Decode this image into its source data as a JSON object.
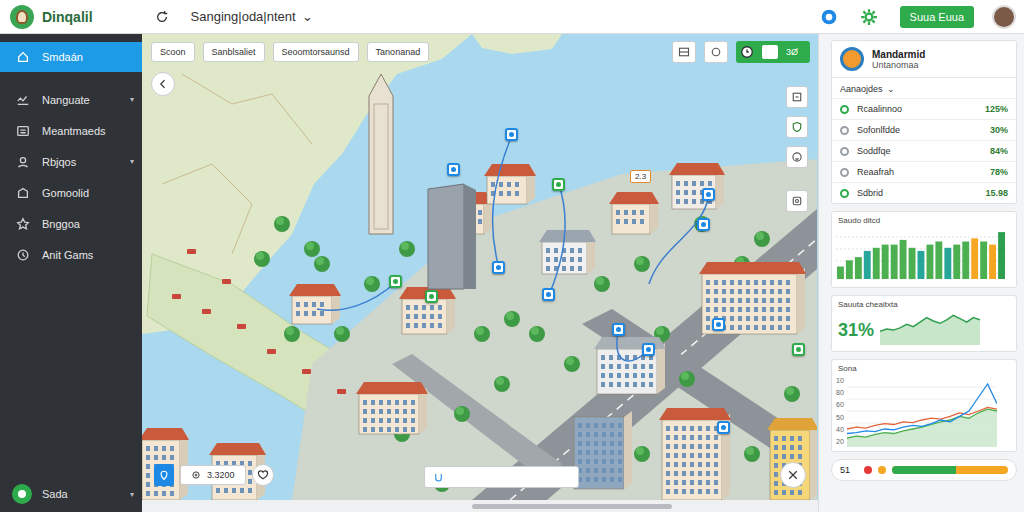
{
  "app": {
    "name": "Dinqalil",
    "project": "Sanging|oda|ntent",
    "project_caret": "⌄"
  },
  "header": {
    "button": "Suua Euua"
  },
  "sidebar": {
    "items": [
      {
        "label": "Smdaán",
        "selected": true,
        "expandable": false
      },
      {
        "label": "Nanguate",
        "selected": false,
        "expandable": true
      },
      {
        "label": "Meantmaeds",
        "selected": false,
        "expandable": false
      },
      {
        "label": "Rbjqos",
        "selected": false,
        "expandable": true
      },
      {
        "label": "Gomoolid",
        "selected": false,
        "expandable": false
      },
      {
        "label": "Bnggoa",
        "selected": false,
        "expandable": false
      },
      {
        "label": "Anit Gams",
        "selected": false,
        "expandable": false
      }
    ],
    "caret": "▾",
    "footer": {
      "label": "Sada",
      "caret": "▾"
    }
  },
  "map": {
    "filters": [
      "Scoon",
      "Sanblsaliet",
      "Seoomtorsaunsd",
      "Tanonanad"
    ],
    "action": "3Ø",
    "badge": "2.3",
    "scale": "3.3200",
    "pins": [
      {
        "color": "#1e88e5"
      },
      {
        "color": "#1e88e5"
      },
      {
        "color": "#2eab4a"
      },
      {
        "color": "#1e88e5"
      },
      {
        "color": "#1e88e5"
      },
      {
        "color": "#1e88e5"
      },
      {
        "color": "#1e88e5"
      },
      {
        "color": "#1e88e5"
      },
      {
        "color": "#1e88e5"
      },
      {
        "color": "#1e88e5"
      },
      {
        "color": "#2eab4a"
      },
      {
        "color": "#1e88e5"
      },
      {
        "color": "#2eab4a"
      },
      {
        "color": "#2eab4a"
      }
    ]
  },
  "panel": {
    "title": "Mandarmid",
    "subtitle": "Untanomaa",
    "list_title": "Aanaojdes",
    "list_caret": "⌄",
    "rows": [
      {
        "label": "Rcaalinnoo",
        "value": "125%",
        "color": "#2eab4a"
      },
      {
        "label": "Sofonlfdde",
        "value": "30%",
        "color": "#9aa0a6"
      },
      {
        "label": "Soddfqe",
        "value": "84%",
        "color": "#9aa0a6"
      },
      {
        "label": "Reaafrah",
        "value": "78%",
        "color": "#9aa0a6"
      },
      {
        "label": "Sdbrid",
        "value": "15.98",
        "color": "#2eab4a"
      }
    ],
    "bar_chart": {
      "title": "Saudo ditcd",
      "bars": [
        {
          "value": 8,
          "color": "#4caf50"
        },
        {
          "value": 12,
          "color": "#4caf50"
        },
        {
          "value": 14,
          "color": "#4caf50"
        },
        {
          "value": 18,
          "color": "#26a69a"
        },
        {
          "value": 20,
          "color": "#4caf50"
        },
        {
          "value": 22,
          "color": "#4caf50"
        },
        {
          "value": 22,
          "color": "#4caf50"
        },
        {
          "value": 25,
          "color": "#4caf50"
        },
        {
          "value": 20,
          "color": "#4caf50"
        },
        {
          "value": 18,
          "color": "#26a69a"
        },
        {
          "value": 22,
          "color": "#4caf50"
        },
        {
          "value": 24,
          "color": "#4caf50"
        },
        {
          "value": 20,
          "color": "#26a69a"
        },
        {
          "value": 22,
          "color": "#4caf50"
        },
        {
          "value": 24,
          "color": "#4caf50"
        },
        {
          "value": 26,
          "color": "#f5a623"
        },
        {
          "value": 24,
          "color": "#4caf50"
        },
        {
          "value": 22,
          "color": "#f5a623"
        },
        {
          "value": 30,
          "color": "#2e9e4f"
        }
      ]
    },
    "stat": {
      "title": "Sauuta cheaitxta",
      "value": "31%",
      "spark": [
        12,
        14,
        13,
        15,
        18,
        16,
        20,
        24,
        21,
        19,
        22,
        26,
        23,
        20,
        24,
        22
      ]
    },
    "line_chart": {
      "title": "Sona",
      "ticks": [
        "10",
        "80",
        "60",
        "50",
        "40",
        "20"
      ],
      "series": [
        {
          "values": [
            10,
            12,
            11,
            14,
            16,
            15,
            18,
            20,
            22,
            25,
            28,
            30,
            34,
            32,
            38,
            42,
            40
          ],
          "color": "#4caf50"
        },
        {
          "values": [
            20,
            22,
            21,
            24,
            26,
            25,
            28,
            27,
            30,
            32,
            31,
            34,
            38,
            36,
            40,
            44,
            42
          ],
          "color": "#e0633a"
        },
        {
          "values": [
            15,
            16,
            18,
            17,
            20,
            19,
            22,
            24,
            23,
            26,
            30,
            28,
            34,
            40,
            55,
            70,
            48
          ],
          "color": "#1e88e5"
        }
      ]
    },
    "bottom": {
      "value": "51",
      "dots": [
        {
          "color": "#e53935"
        },
        {
          "color": "#f5a623"
        }
      ],
      "progress": {
        "level": 0.55
      }
    }
  }
}
